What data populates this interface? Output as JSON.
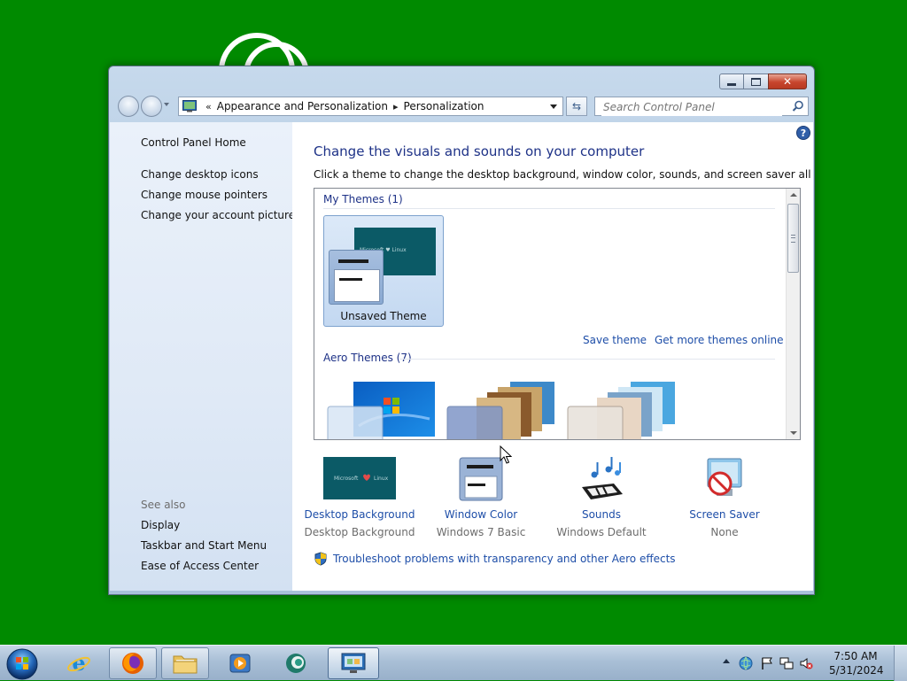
{
  "window": {
    "address": {
      "overflow": "«",
      "crumbs": [
        "Appearance and Personalization",
        "Personalization"
      ]
    },
    "search_placeholder": "Search Control Panel"
  },
  "sidebar": {
    "home": "Control Panel Home",
    "tasks": [
      "Change desktop icons",
      "Change mouse pointers",
      "Change your account picture"
    ],
    "see_also_label": "See also",
    "see_also": [
      "Display",
      "Taskbar and Start Menu",
      "Ease of Access Center"
    ]
  },
  "main": {
    "title": "Change the visuals and sounds on your computer",
    "description": "Click a theme to change the desktop background, window color, sounds, and screen saver all at once.",
    "my_themes": {
      "header": "My Themes (1)",
      "themes": [
        {
          "name": "Unsaved Theme",
          "wallpaper_text": "Microsoft ♥ Linux",
          "selected": true
        }
      ],
      "save_link": "Save theme",
      "more_link": "Get more themes online"
    },
    "aero_themes": {
      "header": "Aero Themes (7)"
    },
    "settings": [
      {
        "label": "Desktop Background",
        "value": "Desktop Background",
        "icon": "desktop-background-icon"
      },
      {
        "label": "Window Color",
        "value": "Windows 7 Basic",
        "icon": "window-color-icon"
      },
      {
        "label": "Sounds",
        "value": "Windows Default",
        "icon": "sounds-icon"
      },
      {
        "label": "Screen Saver",
        "value": "None",
        "icon": "screen-saver-icon"
      }
    ],
    "troubleshoot_link": "Troubleshoot problems with transparency and other Aero effects"
  },
  "taskbar": {
    "items": [
      {
        "name": "internet-explorer",
        "state": "pinned"
      },
      {
        "name": "firefox",
        "state": "running"
      },
      {
        "name": "file-explorer",
        "state": "running"
      },
      {
        "name": "media-player",
        "state": "pinned"
      },
      {
        "name": "remote-app",
        "state": "pinned"
      },
      {
        "name": "control-panel",
        "state": "active"
      }
    ],
    "time": "7:50 AM",
    "date": "5/31/2024"
  },
  "colors": {
    "desktop": "#008a00",
    "title_blue": "#1e3287",
    "link_blue": "#1e4ea8",
    "theme_teal": "#0b5a66",
    "close_red": "#c7452d"
  }
}
